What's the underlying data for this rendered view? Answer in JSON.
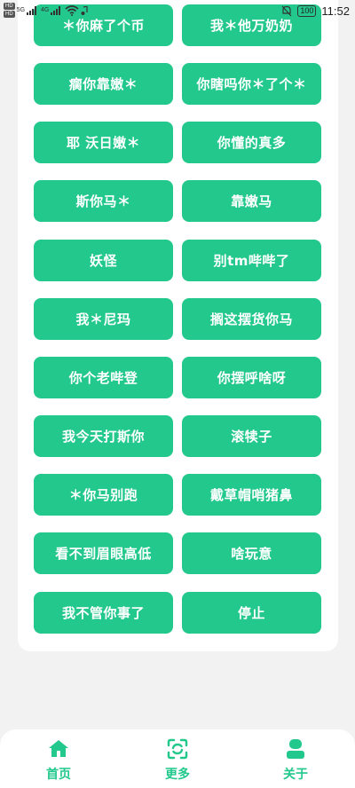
{
  "status_bar": {
    "sim1": "HD",
    "sim2": "HD",
    "net1": "5G",
    "net2": "4G",
    "battery": "100",
    "time": "11:52"
  },
  "buttons": {
    "left": [
      "＊你麻了个币",
      "瘸你靠嫩＊",
      "耶 沃日嫩＊",
      "斯你马＊",
      "妖怪",
      "我＊尼玛",
      "你个老哔登",
      "我今天打斯你",
      "＊你马别跑",
      "看不到眉眼高低",
      "我不管你事了"
    ],
    "right": [
      "我＊他万奶奶",
      "你瞎吗你＊了个＊",
      "你懂的真多",
      "靠嫩马",
      "别tm哔哔了",
      "搁这摆货你马",
      "你摆呼啥呀",
      "滚犊子",
      "戴草帽哨猪鼻",
      "啥玩意",
      "停止"
    ]
  },
  "tabbar": {
    "home_label": "首页",
    "more_label": "更多",
    "about_label": "关于",
    "accent_color": "#23c88d",
    "home_icon": "house-icon",
    "more_icon": "scan-refresh-icon",
    "about_icon": "person-icon"
  }
}
